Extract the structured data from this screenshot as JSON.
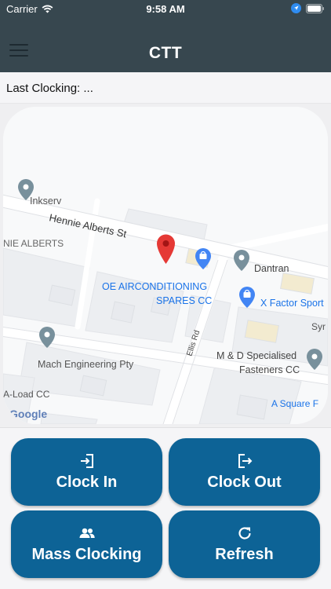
{
  "status_bar": {
    "carrier": "Carrier",
    "time": "9:58 AM"
  },
  "header": {
    "title": "CTT"
  },
  "last_clocking": {
    "text": "Last Clocking: ..."
  },
  "map": {
    "logo": "Google",
    "streets": {
      "hennie_alberts": "Hennie Alberts St",
      "ellis": "Ellis Rd"
    },
    "places": {
      "inkserv": "Inkserv",
      "nie_alberts": "NIE ALBERTS",
      "dantran": "Dantran",
      "oe_line1": "OE AIRCONDITIONING",
      "oe_line2": "SPARES CC",
      "x_factor": "X Factor Sport",
      "syr": "Syr",
      "mach": "Mach Engineering Pty",
      "md_line1": "M & D Specialised",
      "md_line2": "Fasteners CC",
      "a_load": "A-Load CC",
      "a_square": "A Square F"
    }
  },
  "buttons": {
    "clock_in": "Clock In",
    "clock_out": "Clock Out",
    "mass_clocking": "Mass Clocking",
    "refresh": "Refresh"
  },
  "colors": {
    "header": "#37474f",
    "button": "#0d6396",
    "pin": "#e53935",
    "poi_grey": "#78909c",
    "poi_blue": "#1e88e5",
    "text_blue": "#1a73e8"
  }
}
